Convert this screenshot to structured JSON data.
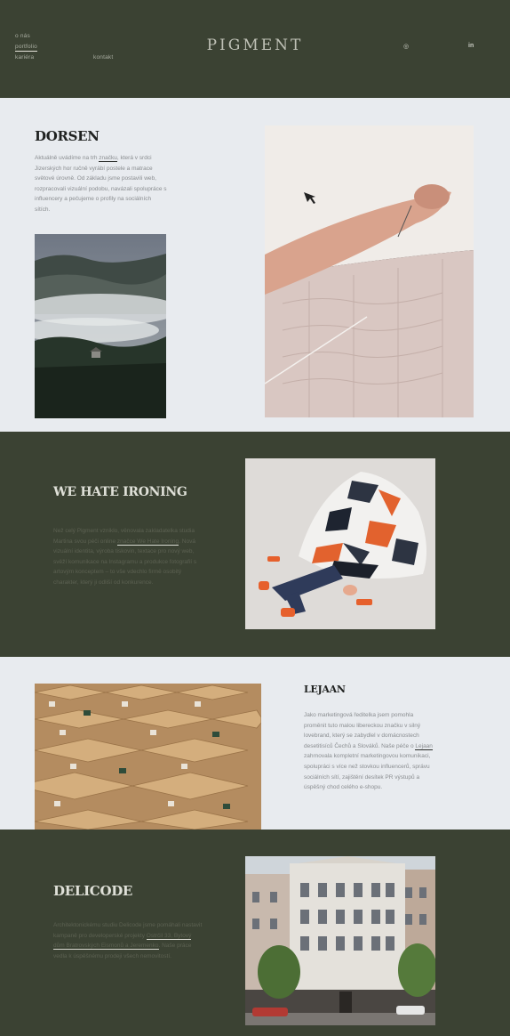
{
  "brand": {
    "logo": "PIGMENT"
  },
  "nav": [
    {
      "label": "o nás"
    },
    {
      "label": "portfolio"
    },
    {
      "label": "kariéra"
    },
    {
      "label": "kontakt"
    }
  ],
  "social": {
    "instagram": "◎",
    "linkedin": "in"
  },
  "projects": {
    "dorsen": {
      "title": "DORSEN",
      "d1": "Aktuálně uvádíme na trh ",
      "d_link": "značku",
      "d2": ", která v srdci Jizerských hor ručně vyrábí postele a matrace světové úrovně. Od základu jsme postavili web, rozpracovali vizuální podobu, navázali spolupráce s influencery a pečujeme o profily na sociálních sítích."
    },
    "wehateironing": {
      "title": "WE HATE IRONING",
      "d1": "Než celý Pigment vzniklo, věnovala zakladatelka studia Martina svou péči online ",
      "d_link": "značce We Hate Ironing",
      "d2": ". Nová vizuální identita, výroba tiskovin, textace pro nový web, svěží komunikace na Instagramu a produkce fotografií s artovým konceptem – to vše vdechlo firmě osobitý charakter, který ji odliší od konkurence."
    },
    "lejaan": {
      "title": "LEJAAN",
      "d1": "Jako marketingová ředitelka jsem pomohla proměnit tuto malou libereckou značku v silný lovebrand, který se zabydlel v domácnostech desetitisíců Čechů a Slováků. Naše péče o ",
      "d_link": "Lejaan",
      "d2": " zahrnovala kompletní marketingovou komunikaci, spolupráci s více než stovkou influencerů, správu sociálních sítí, zajištění desítek PR výstupů a úspěšný chod celého e-shopu."
    },
    "delicode": {
      "title": "DELICODE",
      "d1": "Architektonickému studiu Delicode jsme pomáhali nastavit kampaně pro developerské projekty ",
      "d_link": "Ostrčil 33, Bytový dům Bratrovských Eismonů a Jeremenko",
      "d2": ". Naše práce vedla k úspěšnému prodeji všech nemovitostí."
    }
  },
  "colors": {
    "dark_green": "#3b4233",
    "light_bg": "#e8ebef"
  }
}
